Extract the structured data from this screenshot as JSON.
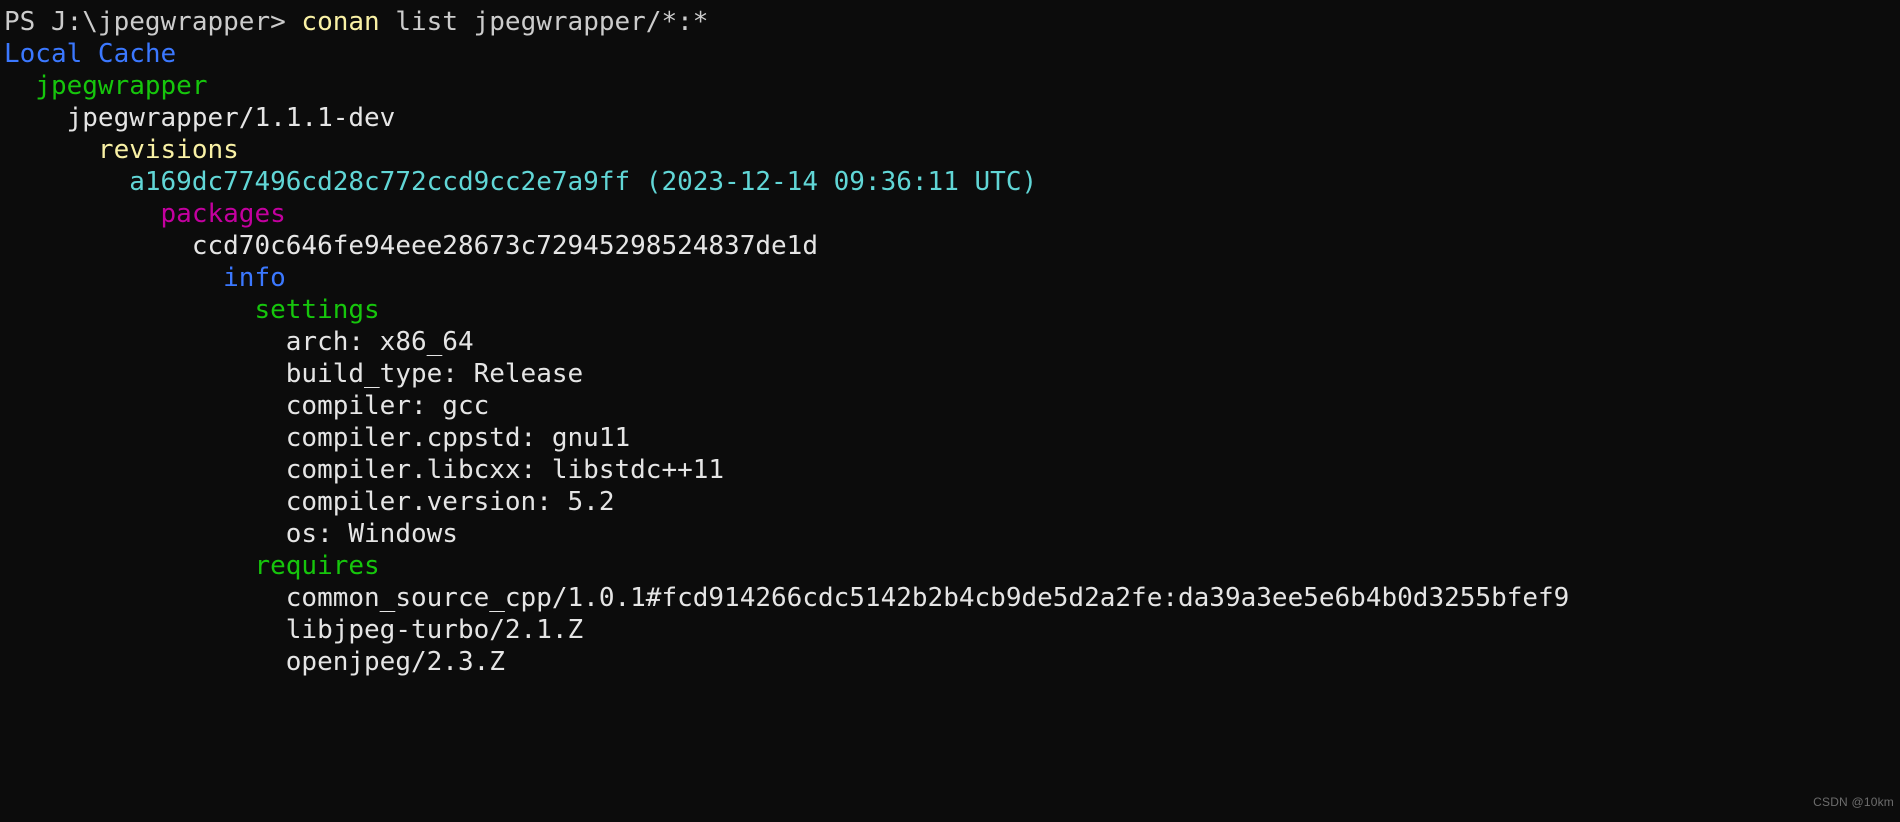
{
  "terminal": {
    "background_color": "#0c0c0c",
    "watermark": "CSDN @10km",
    "colors": {
      "white": "#cccccc",
      "bright_white": "#e5e5e5",
      "yellow": "#f9f1a5",
      "blue": "#3b78ff",
      "green": "#16c60c",
      "cyan": "#61d6d6",
      "magenta": "#c3009f"
    },
    "lines": [
      {
        "id": "line-clipped-top",
        "segments": [
          {
            "text": "",
            "color": "yellow"
          }
        ]
      },
      {
        "id": "line-prompt-command",
        "segments": [
          {
            "text": "PS J:\\jpegwrapper> ",
            "color": "white"
          },
          {
            "text": "conan",
            "color": "yellow"
          },
          {
            "text": " list jpegwrapper/*:*",
            "color": "white"
          }
        ]
      },
      {
        "id": "line-local-cache",
        "segments": [
          {
            "text": "Local Cache",
            "color": "blue"
          }
        ]
      },
      {
        "id": "line-recipe-name",
        "segments": [
          {
            "text": "  jpegwrapper",
            "color": "green"
          }
        ]
      },
      {
        "id": "line-recipe-version",
        "segments": [
          {
            "text": "    jpegwrapper/1.1.1-dev",
            "color": "bright_white"
          }
        ]
      },
      {
        "id": "line-revisions-header",
        "segments": [
          {
            "text": "      revisions",
            "color": "yellow"
          }
        ]
      },
      {
        "id": "line-recipe-revision",
        "segments": [
          {
            "text": "        a169dc77496cd28c772ccd9cc2e7a9ff (2023-12-14 09:36:11 UTC)",
            "color": "cyan"
          }
        ]
      },
      {
        "id": "line-packages-header",
        "segments": [
          {
            "text": "          packages",
            "color": "magenta"
          }
        ]
      },
      {
        "id": "line-package-id",
        "segments": [
          {
            "text": "            ccd70c646fe94eee28673c72945298524837de1d",
            "color": "bright_white"
          }
        ]
      },
      {
        "id": "line-info-header",
        "segments": [
          {
            "text": "              info",
            "color": "blue"
          }
        ]
      },
      {
        "id": "line-settings-header",
        "segments": [
          {
            "text": "                settings",
            "color": "green"
          }
        ]
      },
      {
        "id": "line-setting-arch",
        "segments": [
          {
            "text": "                  arch: x86_64",
            "color": "bright_white"
          }
        ]
      },
      {
        "id": "line-setting-build-type",
        "segments": [
          {
            "text": "                  build_type: Release",
            "color": "bright_white"
          }
        ]
      },
      {
        "id": "line-setting-compiler",
        "segments": [
          {
            "text": "                  compiler: gcc",
            "color": "bright_white"
          }
        ]
      },
      {
        "id": "line-setting-compiler-cppstd",
        "segments": [
          {
            "text": "                  compiler.cppstd: gnu11",
            "color": "bright_white"
          }
        ]
      },
      {
        "id": "line-setting-compiler-libcxx",
        "segments": [
          {
            "text": "                  compiler.libcxx: libstdc++11",
            "color": "bright_white"
          }
        ]
      },
      {
        "id": "line-setting-compiler-version",
        "segments": [
          {
            "text": "                  compiler.version: 5.2",
            "color": "bright_white"
          }
        ]
      },
      {
        "id": "line-setting-os",
        "segments": [
          {
            "text": "                  os: Windows",
            "color": "bright_white"
          }
        ]
      },
      {
        "id": "line-requires-header",
        "segments": [
          {
            "text": "                requires",
            "color": "green"
          }
        ]
      },
      {
        "id": "line-require-common-source-cpp",
        "segments": [
          {
            "text": "                  common_source_cpp/1.0.1#fcd914266cdc5142b2b4cb9de5d2a2fe:da39a3ee5e6b4b0d3255bfef9",
            "color": "bright_white"
          }
        ]
      },
      {
        "id": "line-require-libjpeg-turbo",
        "segments": [
          {
            "text": "                  libjpeg-turbo/2.1.Z",
            "color": "bright_white"
          }
        ]
      },
      {
        "id": "line-require-openjpeg",
        "segments": [
          {
            "text": "                  openjpeg/2.3.Z",
            "color": "bright_white"
          }
        ]
      }
    ]
  }
}
